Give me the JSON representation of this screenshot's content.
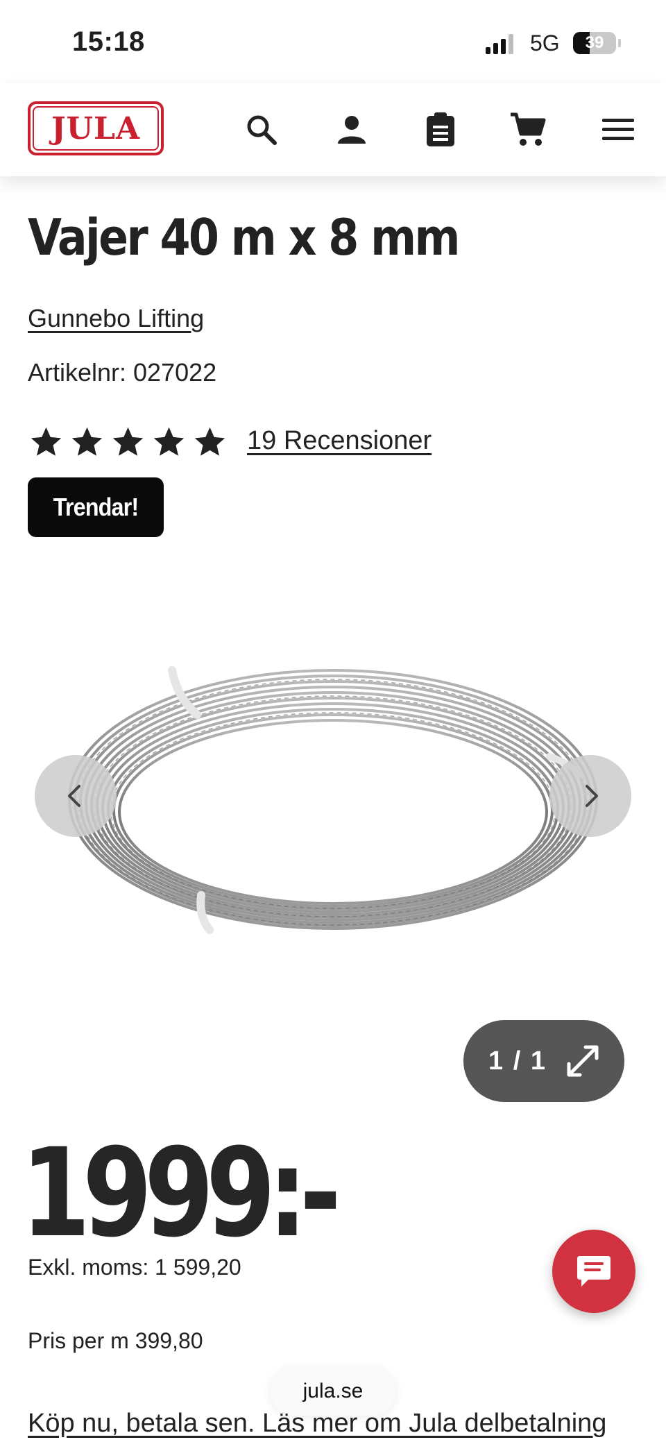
{
  "status_bar": {
    "time": "15:18",
    "network": "5G",
    "battery": "39",
    "battery_level": 0.39
  },
  "header": {
    "logo_text": "JULA",
    "icons": [
      "search-icon",
      "user-icon",
      "clipboard-icon",
      "cart-icon",
      "menu-icon"
    ],
    "brand_color": "#c8202f"
  },
  "product": {
    "title": "Vajer 40 m x 8 mm",
    "brand": "Gunnebo Lifting",
    "article_number": "Artikelnr: 027022",
    "rating": 5,
    "reviews": "19 Recensioner",
    "badge": "Trendar!"
  },
  "gallery": {
    "counter": "1 / 1"
  },
  "pricing": {
    "price": "1999:-",
    "excl_vat": "Exkl. moms: 1 599,20",
    "price_per_m": "Pris per m 399,80"
  },
  "browser": {
    "url": "jula.se"
  },
  "financing": {
    "link_text": "Köp nu, betala sen. Läs mer om Jula delbetalning"
  }
}
